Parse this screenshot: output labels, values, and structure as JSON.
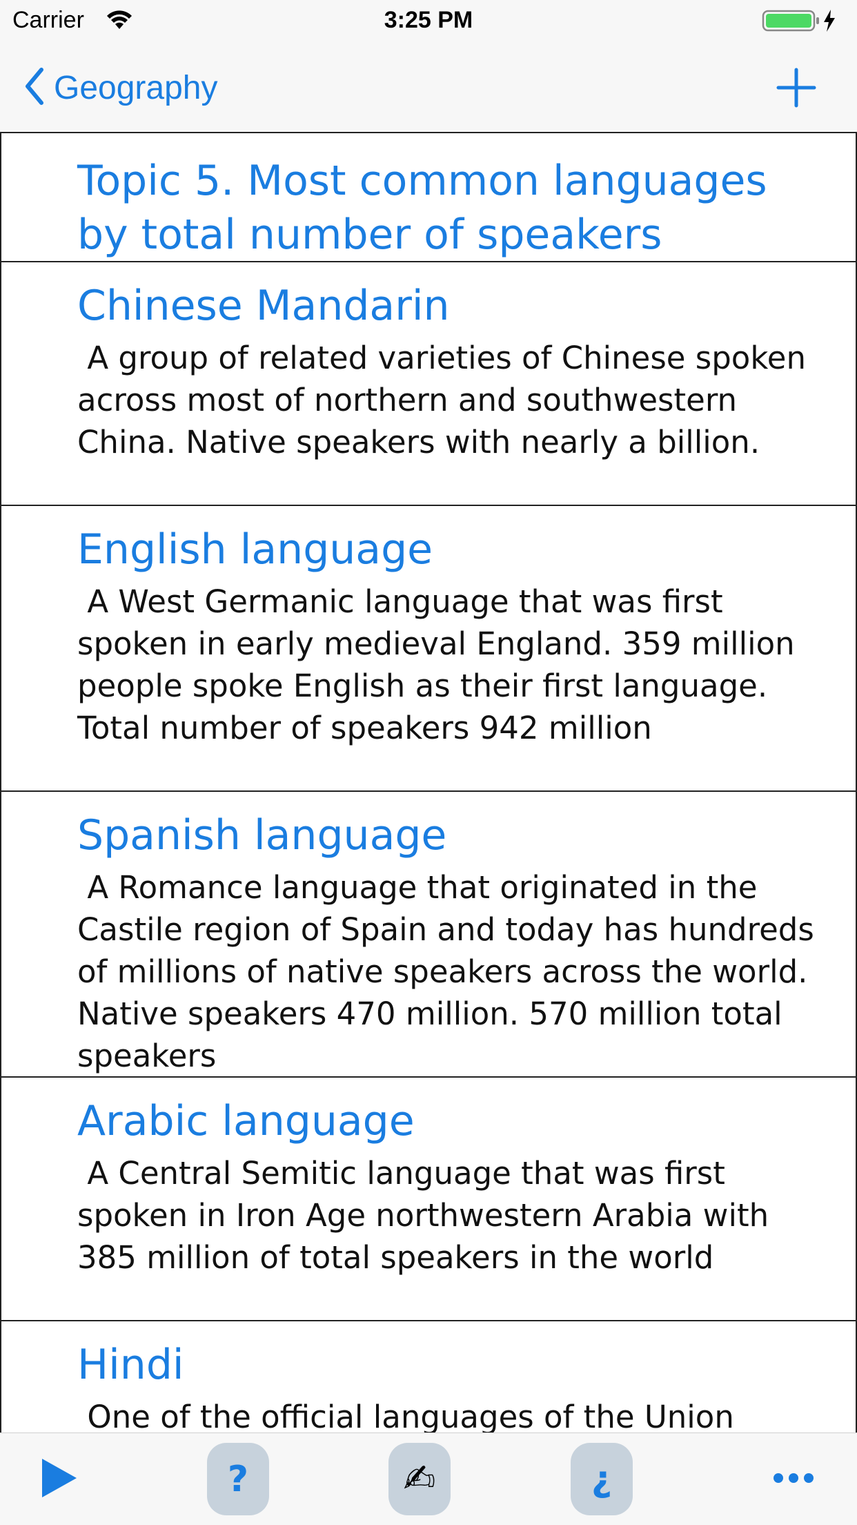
{
  "status_bar": {
    "carrier": "Carrier",
    "time": "3:25 PM",
    "wifi_icon": "wifi-icon",
    "battery_icon": "battery-charging-icon",
    "battery_color": "#4cd964"
  },
  "nav": {
    "back_label": "Geography",
    "back_icon": "chevron-left-icon",
    "add_icon": "plus-icon",
    "accent_color": "#1a7de0"
  },
  "topic": {
    "title": "Topic 5. Most common languages by total number of speakers"
  },
  "items": [
    {
      "title": "Chinese Mandarin",
      "description": " A group of related varieties of Chinese spoken across most of northern and southwestern China. Native speakers with nearly a billion."
    },
    {
      "title": "English language",
      "description": " A West Germanic language that was first spoken in early medieval England. 359 million people spoke English as their first language. Total number of speakers 942 million"
    },
    {
      "title": "Spanish language",
      "description": " A Romance language that originated in the Castile region of Spain and today has hundreds of millions of native speakers across the world. Native speakers 470 million. 570 million total speakers"
    },
    {
      "title": "Arabic language",
      "description": " A Central Semitic language that was first spoken in Iron Age northwestern Arabia with 385 million of total speakers in the world"
    },
    {
      "title": "Hindi",
      "description": " One of the official languages of the Union"
    }
  ],
  "toolbar": {
    "play_icon": "play-icon",
    "help_label": "?",
    "write_label": "✍",
    "inverted_help_label": "¿",
    "more_icon": "ellipsis-icon"
  }
}
